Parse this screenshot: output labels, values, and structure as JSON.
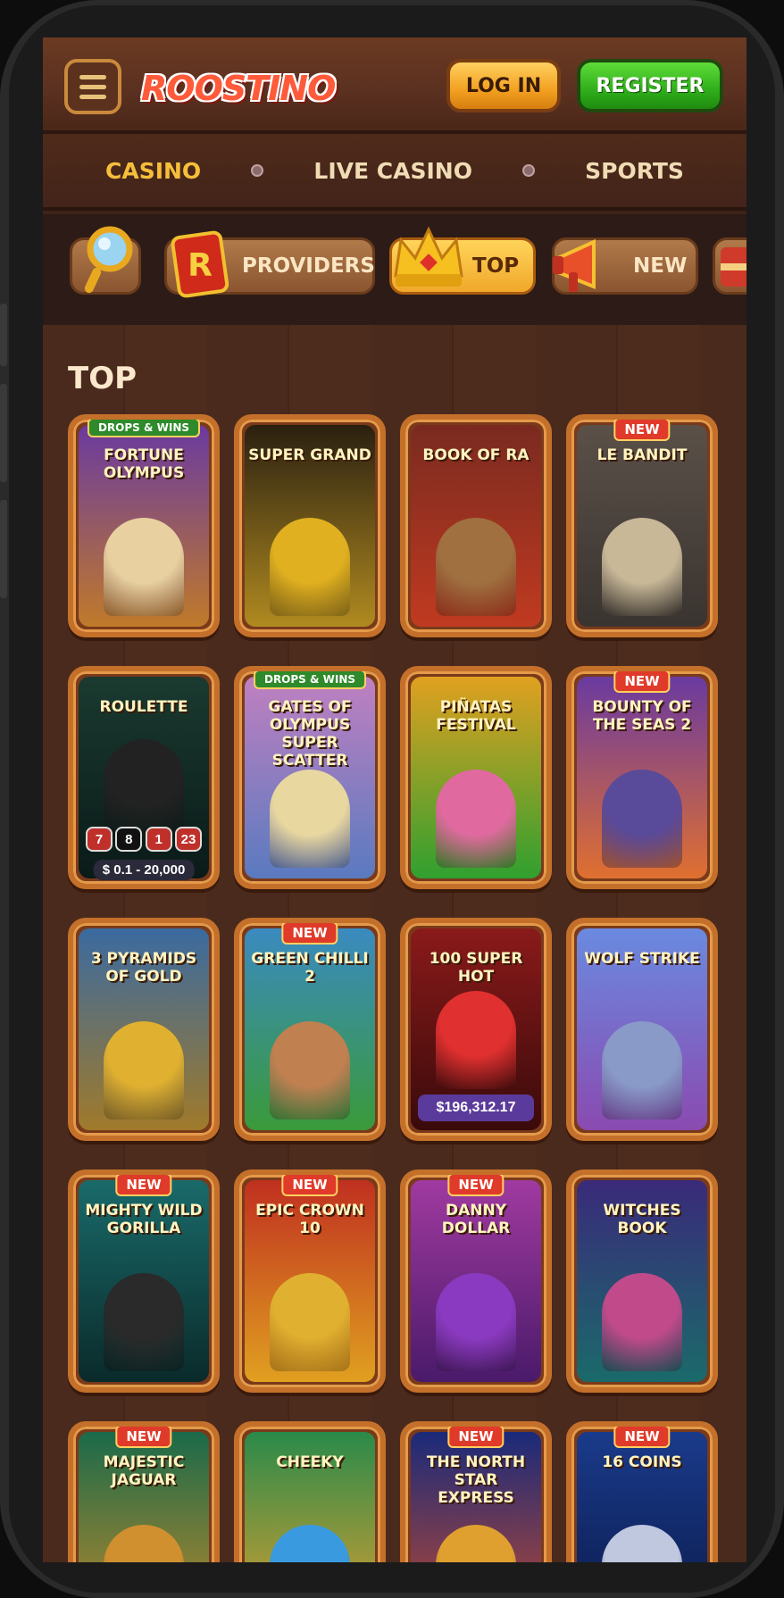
{
  "header": {
    "logo_text": "ROOSTINO",
    "login_label": "LOG IN",
    "register_label": "REGISTER"
  },
  "main_nav": {
    "items": [
      {
        "label": "CASINO",
        "active": true
      },
      {
        "label": "LIVE CASINO",
        "active": false
      },
      {
        "label": "SPORTS",
        "active": false
      }
    ]
  },
  "categories": {
    "items": [
      {
        "label": "",
        "icon": "magnifier-icon"
      },
      {
        "label": "PROVIDERS",
        "icon": "providers-r-icon"
      },
      {
        "label": "TOP",
        "icon": "crown-icon",
        "active": true
      },
      {
        "label": "NEW",
        "icon": "megaphone-icon"
      }
    ]
  },
  "section": {
    "title": "TOP"
  },
  "games": [
    {
      "name": "FORTUNE OLYMPUS",
      "badge": "DROPS & WINS",
      "badge_type": "drops",
      "bg": "#6a3aa0",
      "bg2": "#c07a2a",
      "fig": "#e8d0a0"
    },
    {
      "name": "SUPER GRAND",
      "badge": "",
      "badge_type": "",
      "bg": "#2a2010",
      "bg2": "#b08a20",
      "fig": "#e0b020"
    },
    {
      "name": "BOOK OF RA",
      "badge": "",
      "badge_type": "",
      "bg": "#7a2a20",
      "bg2": "#c03a20",
      "fig": "#a07040"
    },
    {
      "name": "LE BANDIT",
      "badge": "NEW",
      "badge_type": "new",
      "bg": "#5a5048",
      "bg2": "#3a3430",
      "fig": "#c8b898"
    },
    {
      "name": "ROULETTE",
      "badge": "",
      "badge_type": "",
      "bg": "#1a3a30",
      "bg2": "#0a1a18",
      "fig": "#222222",
      "stake": "$ 0.1 - 20,000",
      "numbers": [
        "7",
        "8",
        "1",
        "23"
      ]
    },
    {
      "name": "GATES OF OLYMPUS SUPER SCATTER",
      "badge": "DROPS & WINS",
      "badge_type": "drops",
      "bg": "#c080c0",
      "bg2": "#5a7ac0",
      "fig": "#e8d8a0"
    },
    {
      "name": "PIÑATAS FESTIVAL",
      "badge": "",
      "badge_type": "",
      "bg": "#e0a020",
      "bg2": "#30a030",
      "fig": "#e06aa0"
    },
    {
      "name": "BOUNTY OF THE SEAS 2",
      "badge": "NEW",
      "badge_type": "new",
      "bg": "#6a3aa0",
      "bg2": "#e07030",
      "fig": "#5a4a9a"
    },
    {
      "name": "3 PYRAMIDS OF GOLD",
      "badge": "",
      "badge_type": "",
      "bg": "#3a6aa0",
      "bg2": "#a07a2a",
      "fig": "#e0b030"
    },
    {
      "name": "GREEN CHILLI 2",
      "badge": "NEW",
      "badge_type": "new",
      "bg": "#3a8ac0",
      "bg2": "#3a9a3a",
      "fig": "#c08050"
    },
    {
      "name": "100 SUPER HOT",
      "badge": "",
      "badge_type": "",
      "bg": "#8a1a1a",
      "bg2": "#3a0a0a",
      "fig": "#e03030",
      "jackpot": "$196,312.17"
    },
    {
      "name": "WOLF STRIKE",
      "badge": "",
      "badge_type": "",
      "bg": "#6a8ae0",
      "bg2": "#8a4ab0",
      "fig": "#8a9ac8"
    },
    {
      "name": "MIGHTY WILD GORILLA",
      "badge": "NEW",
      "badge_type": "new",
      "bg": "#1a6a6a",
      "bg2": "#0a2a2a",
      "fig": "#2a2a2a"
    },
    {
      "name": "EPIC CROWN 10",
      "badge": "NEW",
      "badge_type": "new",
      "bg": "#c03020",
      "bg2": "#e0a020",
      "fig": "#e0b030"
    },
    {
      "name": "DANNY DOLLAR",
      "badge": "NEW",
      "badge_type": "new",
      "bg": "#a03aa0",
      "bg2": "#4a1a6a",
      "fig": "#8a3ac0"
    },
    {
      "name": "WITCHES BOOK",
      "badge": "",
      "badge_type": "",
      "bg": "#3a2a7a",
      "bg2": "#1a6a6a",
      "fig": "#c04a8a"
    },
    {
      "name": "MAJESTIC JAGUAR",
      "badge": "NEW",
      "badge_type": "new",
      "bg": "#1a6a4a",
      "bg2": "#c08a2a",
      "fig": "#d09030"
    },
    {
      "name": "CHEEKY",
      "badge": "",
      "badge_type": "",
      "bg": "#2a8a4a",
      "bg2": "#e0a030",
      "fig": "#3a9ae0"
    },
    {
      "name": "THE NORTH STAR EXPRESS",
      "badge": "NEW",
      "badge_type": "new",
      "bg": "#1a2a7a",
      "bg2": "#c04a30",
      "fig": "#e0a030"
    },
    {
      "name": "16 COINS",
      "badge": "NEW",
      "badge_type": "new",
      "bg": "#1a3a8a",
      "bg2": "#0a1a4a",
      "fig": "#c0c8e0"
    }
  ],
  "colors": {
    "accent_gold": "#f6bf3a",
    "register_green": "#2fae1a",
    "new_badge": "#e03a2a",
    "tile_frame": "#c4702a"
  }
}
